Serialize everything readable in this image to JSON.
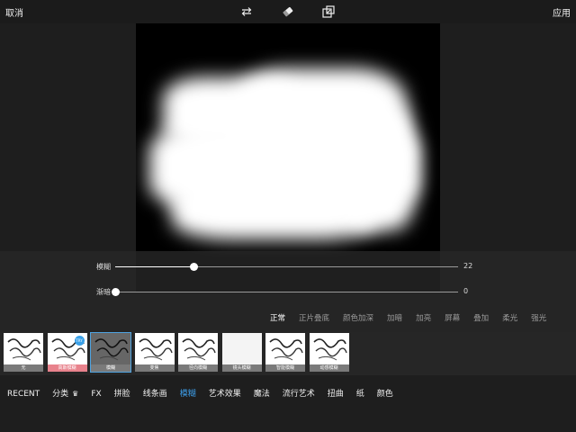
{
  "topbar": {
    "cancel_label": "取消",
    "apply_label": "应用",
    "icons": [
      "swap-icon",
      "eraser-icon",
      "resize-icon"
    ]
  },
  "sliders": [
    {
      "label": "模糊",
      "value": "22",
      "level": 0.22
    },
    {
      "label": "渐暗",
      "value": "0",
      "level": 0
    }
  ],
  "blend_modes": [
    "正常",
    "正片叠底",
    "颜色加深",
    "加暗",
    "加亮",
    "屏幕",
    "叠加",
    "柔光",
    "强光"
  ],
  "blend_selected": 0,
  "filters": [
    {
      "caption": "无",
      "badge": ""
    },
    {
      "caption": "高斯模糊",
      "badge": "TRY"
    },
    {
      "caption": "模糊",
      "badge": ""
    },
    {
      "caption": "变焦",
      "badge": ""
    },
    {
      "caption": "径向模糊",
      "badge": ""
    },
    {
      "caption": "镜头模糊",
      "badge": ""
    },
    {
      "caption": "智能模糊",
      "badge": ""
    },
    {
      "caption": "动感模糊",
      "badge": ""
    }
  ],
  "filter_selected": 2,
  "categories": [
    "RECENT",
    "分类",
    "FX",
    "拼脸",
    "线条画",
    "模糊",
    "艺术效果",
    "魔法",
    "流行艺术",
    "扭曲",
    "纸",
    "颜色"
  ],
  "category_selected": 5,
  "colors": {
    "accent": "#3d9ce6",
    "badge": "#39a0e8",
    "crown": "#e6b93a"
  }
}
